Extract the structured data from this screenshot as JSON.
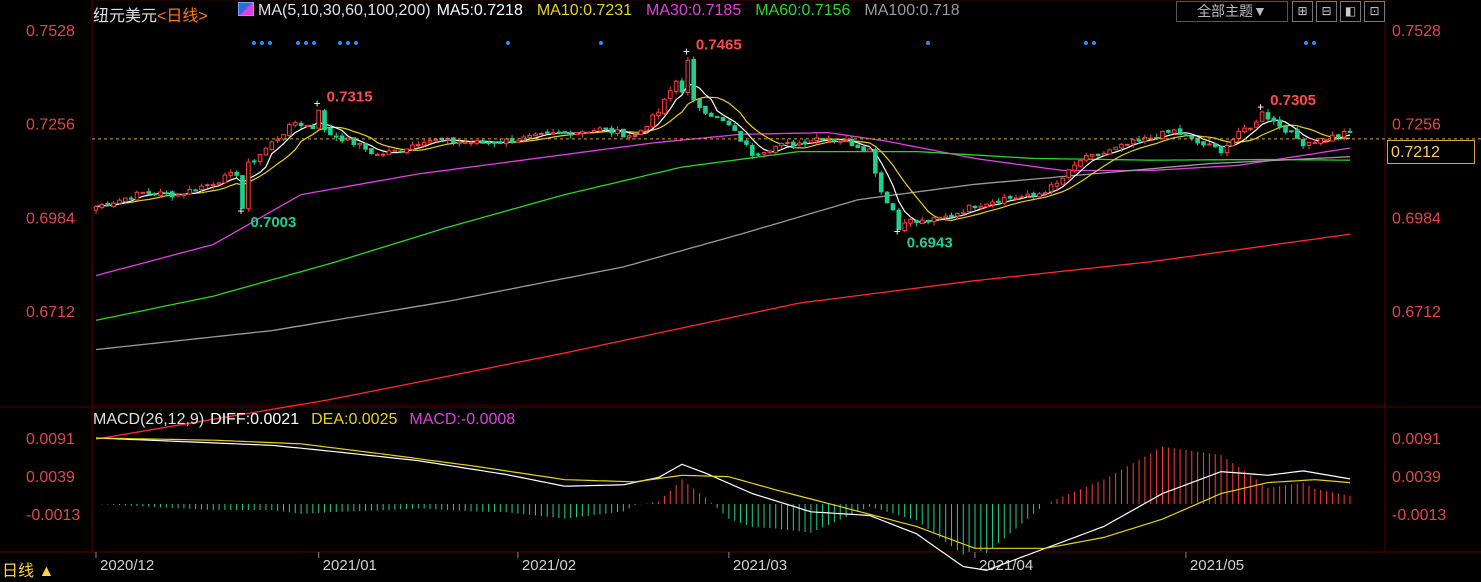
{
  "header": {
    "symbol": "纽元美元",
    "period": "<日线>",
    "ma_params": "MA(5,10,30,60,100,200)",
    "ma5": "MA5:0.7218",
    "ma10": "MA10:0.7231",
    "ma30": "MA30:0.7185",
    "ma60": "MA60:0.7156",
    "ma100": "MA100:0.718"
  },
  "toolbar": {
    "theme_label": "全部主题▼",
    "buttons": [
      "⊞",
      "⊟",
      "◧",
      "⊡"
    ]
  },
  "colors": {
    "up": "#ff3b3b",
    "down": "#1fcf8f",
    "ma5": "#ffffff",
    "ma10": "#e6d21c",
    "ma30": "#e040e0",
    "ma60": "#2bd62b",
    "ma100": "#9a9a9a",
    "ma200": "#ff2a2a",
    "axis_text": "#e04848",
    "dea": "#e6d21c",
    "diff": "#ffffff"
  },
  "current_price": "0.7212",
  "period_tab": "日线 ▲",
  "chart_data": [
    {
      "type": "candlestick",
      "y_ticks": [
        "0.7528",
        "0.7256",
        "0.6984",
        "0.6712"
      ],
      "x_ticks": [
        "2020/12",
        "2021/01",
        "2021/02",
        "2021/03",
        "2021/04",
        "2021/05"
      ],
      "annotations": [
        {
          "label": "0.7465",
          "kind": "high"
        },
        {
          "label": "0.7315",
          "kind": "high"
        },
        {
          "label": "0.7305",
          "kind": "high"
        },
        {
          "label": "0.7003",
          "kind": "low"
        },
        {
          "label": "0.6943",
          "kind": "low"
        }
      ],
      "anchors": [
        [
          0,
          0.7015
        ],
        [
          8,
          0.7055
        ],
        [
          14,
          0.705
        ],
        [
          20,
          0.7085
        ],
        [
          25,
          0.712
        ],
        [
          30,
          0.72
        ],
        [
          34,
          0.726
        ],
        [
          38,
          0.724
        ],
        [
          44,
          0.72
        ],
        [
          48,
          0.7165
        ],
        [
          52,
          0.718
        ],
        [
          56,
          0.721
        ],
        [
          60,
          0.7205
        ],
        [
          66,
          0.72
        ],
        [
          72,
          0.721
        ],
        [
          80,
          0.723
        ],
        [
          86,
          0.724
        ],
        [
          92,
          0.722
        ],
        [
          96,
          0.729
        ],
        [
          99,
          0.738
        ],
        [
          101,
          0.733
        ],
        [
          104,
          0.7295
        ],
        [
          108,
          0.725
        ],
        [
          112,
          0.717
        ],
        [
          116,
          0.719
        ],
        [
          120,
          0.72
        ],
        [
          124,
          0.722
        ],
        [
          128,
          0.7205
        ],
        [
          132,
          0.718
        ],
        [
          134,
          0.706
        ],
        [
          137,
          0.698
        ],
        [
          140,
          0.697
        ],
        [
          143,
          0.6975
        ],
        [
          146,
          0.699
        ],
        [
          150,
          0.702
        ],
        [
          155,
          0.704
        ],
        [
          160,
          0.7045
        ],
        [
          164,
          0.708
        ],
        [
          168,
          0.715
        ],
        [
          172,
          0.717
        ],
        [
          176,
          0.7195
        ],
        [
          180,
          0.7215
        ],
        [
          184,
          0.7235
        ],
        [
          188,
          0.72
        ],
        [
          192,
          0.718
        ],
        [
          196,
          0.724
        ],
        [
          200,
          0.7275
        ],
        [
          203,
          0.724
        ],
        [
          206,
          0.72
        ],
        [
          209,
          0.721
        ],
        [
          214,
          0.723
        ]
      ],
      "ma_lines": [
        {
          "name": "MA30",
          "points": [
            [
              0,
              0.6815
            ],
            [
              20,
              0.6905
            ],
            [
              35,
              0.705
            ],
            [
              55,
              0.711
            ],
            [
              75,
              0.7155
            ],
            [
              95,
              0.72
            ],
            [
              110,
              0.7225
            ],
            [
              125,
              0.723
            ],
            [
              135,
              0.7205
            ],
            [
              150,
              0.7155
            ],
            [
              165,
              0.712
            ],
            [
              180,
              0.712
            ],
            [
              195,
              0.7135
            ],
            [
              214,
              0.7185
            ]
          ]
        },
        {
          "name": "MA60",
          "points": [
            [
              0,
              0.6685
            ],
            [
              20,
              0.6755
            ],
            [
              40,
              0.685
            ],
            [
              60,
              0.6955
            ],
            [
              80,
              0.705
            ],
            [
              100,
              0.713
            ],
            [
              120,
              0.7175
            ],
            [
              140,
              0.7175
            ],
            [
              160,
              0.7155
            ],
            [
              180,
              0.715
            ],
            [
              200,
              0.7152
            ],
            [
              214,
              0.715
            ]
          ]
        },
        {
          "name": "MA100",
          "points": [
            [
              0,
              0.66
            ],
            [
              30,
              0.6655
            ],
            [
              60,
              0.674
            ],
            [
              90,
              0.684
            ],
            [
              110,
              0.6935
            ],
            [
              130,
              0.7035
            ],
            [
              150,
              0.708
            ],
            [
              170,
              0.711
            ],
            [
              190,
              0.714
            ],
            [
              214,
              0.716
            ]
          ]
        },
        {
          "name": "MA200",
          "points": [
            [
              0,
              0.634
            ],
            [
              40,
              0.6455
            ],
            [
              80,
              0.659
            ],
            [
              120,
              0.6735
            ],
            [
              150,
              0.68
            ],
            [
              180,
              0.6855
            ],
            [
              214,
              0.6935
            ]
          ]
        }
      ]
    },
    {
      "type": "macd",
      "title": "MACD(26,12,9)",
      "diff_label": "DIFF:0.0021",
      "dea_label": "DEA:0.0025",
      "macd_label": "MACD:-0.0008",
      "y_ticks": [
        "0.0091",
        "0.0039",
        "-0.0013"
      ],
      "diff_anchors": [
        [
          0,
          0.0091
        ],
        [
          15,
          0.0086
        ],
        [
          30,
          0.0081
        ],
        [
          40,
          0.0073
        ],
        [
          55,
          0.006
        ],
        [
          70,
          0.0041
        ],
        [
          80,
          0.0025
        ],
        [
          90,
          0.0027
        ],
        [
          96,
          0.0037
        ],
        [
          100,
          0.0055
        ],
        [
          104,
          0.0043
        ],
        [
          112,
          0.0015
        ],
        [
          122,
          -0.001
        ],
        [
          132,
          -0.0015
        ],
        [
          140,
          -0.004
        ],
        [
          148,
          -0.0085
        ],
        [
          152,
          -0.009
        ],
        [
          162,
          -0.006
        ],
        [
          172,
          -0.003
        ],
        [
          182,
          0.0015
        ],
        [
          192,
          0.0045
        ],
        [
          200,
          0.004
        ],
        [
          206,
          0.0046
        ],
        [
          214,
          0.0035
        ]
      ],
      "dea_anchors": [
        [
          0,
          0.0091
        ],
        [
          20,
          0.0088
        ],
        [
          35,
          0.0083
        ],
        [
          50,
          0.0068
        ],
        [
          65,
          0.0052
        ],
        [
          80,
          0.0034
        ],
        [
          92,
          0.0031
        ],
        [
          100,
          0.004
        ],
        [
          108,
          0.0038
        ],
        [
          116,
          0.002
        ],
        [
          128,
          -0.0005
        ],
        [
          140,
          -0.003
        ],
        [
          150,
          -0.006
        ],
        [
          162,
          -0.006
        ],
        [
          172,
          -0.0045
        ],
        [
          182,
          -0.002
        ],
        [
          192,
          0.0015
        ],
        [
          200,
          0.003
        ],
        [
          208,
          0.0034
        ],
        [
          214,
          0.003
        ]
      ]
    }
  ]
}
